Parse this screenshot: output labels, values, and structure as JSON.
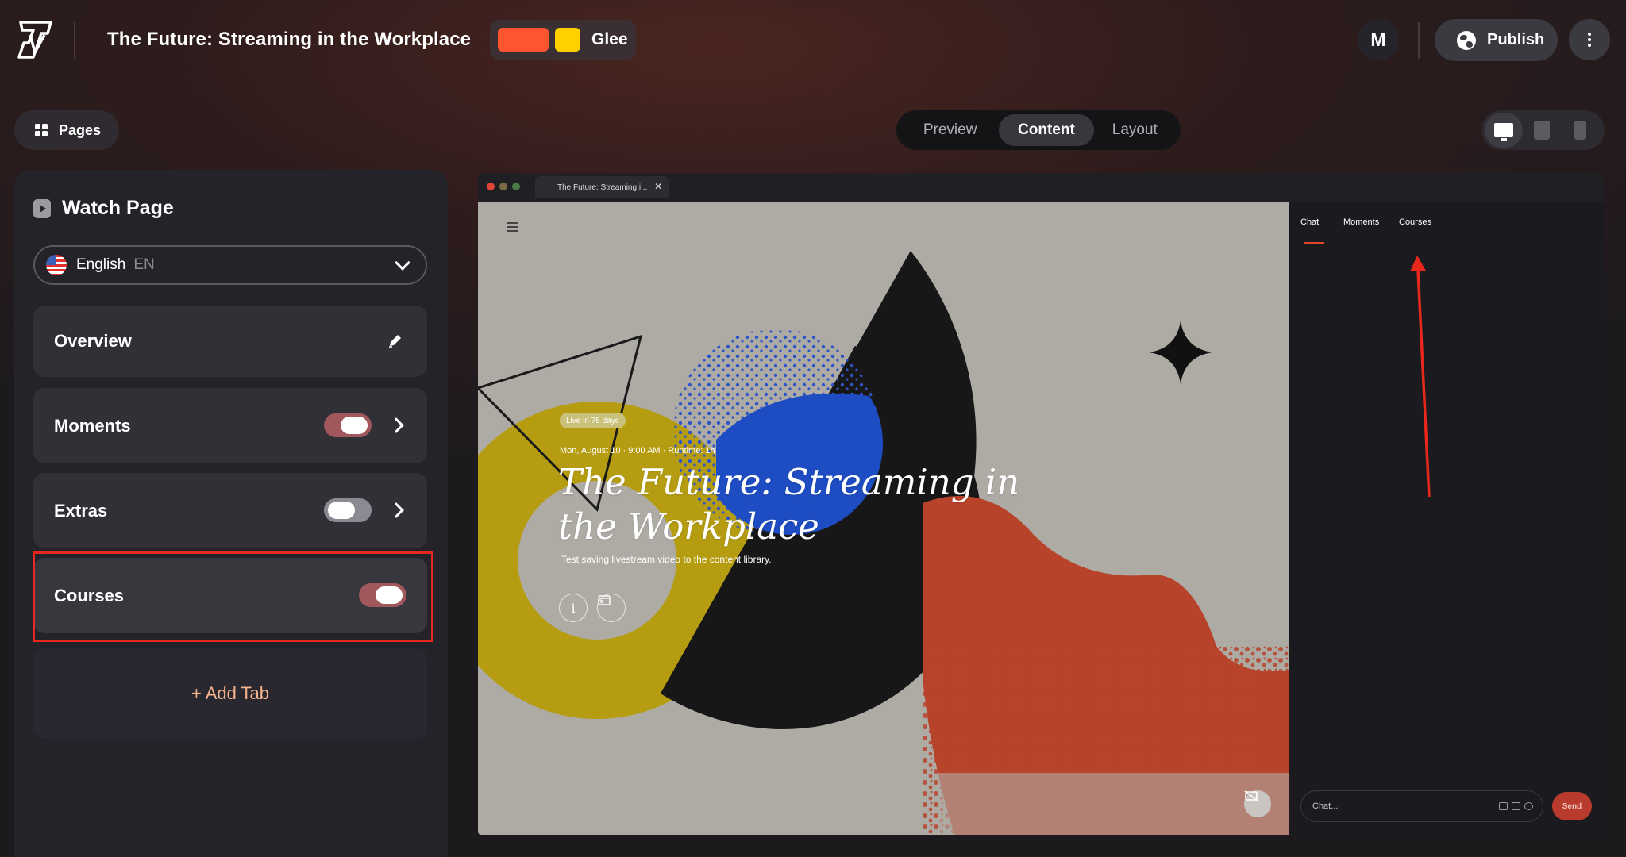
{
  "app": {
    "title": "The Future: Streaming in the Workplace",
    "theme_name": "Glee",
    "theme_colors": [
      "#fc5530",
      "#ffd100"
    ],
    "avatar_initial": "M",
    "publish_label": "Publish"
  },
  "toolbar": {
    "pages_label": "Pages",
    "modes": [
      {
        "label": "Preview",
        "active": false
      },
      {
        "label": "Content",
        "active": true
      },
      {
        "label": "Layout",
        "active": false
      }
    ],
    "devices": [
      {
        "name": "desktop-icon",
        "active": true
      },
      {
        "name": "tablet-icon",
        "active": false
      },
      {
        "name": "phone-icon",
        "active": false
      }
    ]
  },
  "panel": {
    "title": "Watch Page",
    "language": {
      "name": "English",
      "code": "EN"
    },
    "tabs": [
      {
        "label": "Overview",
        "control": "edit"
      },
      {
        "label": "Moments",
        "toggle": true,
        "has_chevron": true
      },
      {
        "label": "Extras",
        "toggle": false,
        "has_chevron": true
      },
      {
        "label": "Courses",
        "toggle": true,
        "has_chevron": false,
        "highlighted": true
      }
    ],
    "add_tab_label": "+ Add Tab"
  },
  "preview": {
    "browser_tab_title": "The Future: Streaming i...",
    "live_badge": "Live in 75 days",
    "event_date": "Mon, August 10 · 9:00 AM · Runtime: 1h",
    "event_title": "The Future: Streaming in the Workplace",
    "event_description": "Test saving livestream video to the content library.",
    "chat_tabs": [
      "Chat",
      "Moments",
      "Courses"
    ],
    "active_chat_tab": "Chat",
    "chat_placeholder": "Chat...",
    "send_label": "Send"
  },
  "colors": {
    "accent": "#e0482b",
    "highlight": "#e8281c",
    "toggle_on": "#a0585c",
    "toggle_off": "#8b8a92",
    "add_tab_text": "#f6b58e"
  }
}
